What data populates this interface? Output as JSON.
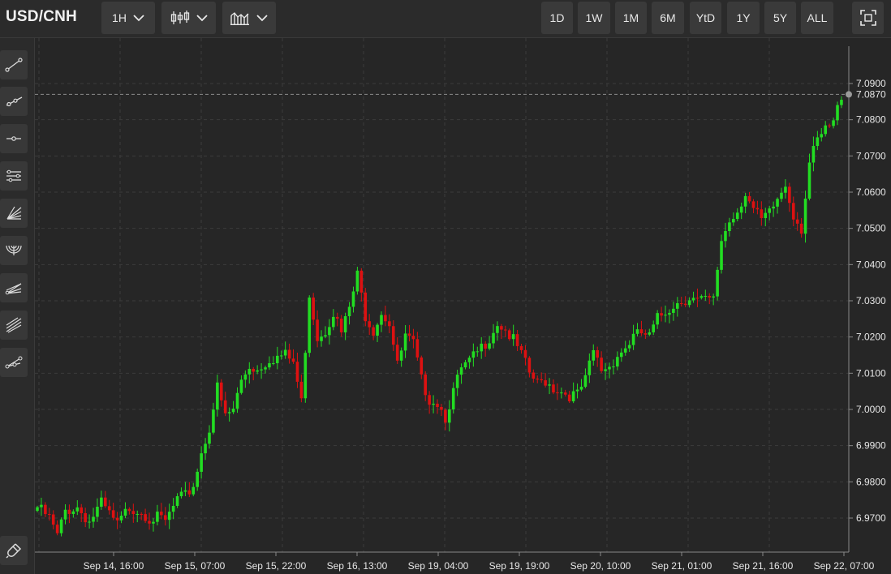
{
  "symbol": "USD/CNH",
  "toolbar": {
    "interval_label": "1H",
    "ranges": [
      "1D",
      "1W",
      "1M",
      "6M",
      "YtD",
      "1Y",
      "5Y",
      "ALL"
    ]
  },
  "sidebar_tools": [
    "trend-line-icon",
    "ray-icon",
    "horizontal-line-icon",
    "parallel-channel-icon",
    "fan-icon",
    "arc-icon",
    "pitchfork-icon",
    "multi-line-icon",
    "path-icon"
  ],
  "colors": {
    "up": "#22dd22",
    "down": "#dd1111",
    "background": "#262626",
    "grid": "#3c3c3c"
  },
  "chart_data": {
    "type": "candlestick",
    "y_ticks": [
      "7.0900",
      "7.0800",
      "7.0700",
      "7.0600",
      "7.0500",
      "7.0400",
      "7.0300",
      "7.0200",
      "7.0100",
      "7.0000",
      "6.9900",
      "6.9800",
      "6.9700"
    ],
    "ylim": [
      6.9655,
      7.0995
    ],
    "current_price": "7.0870",
    "x_tick_labels": [
      "Sep 14, 16:00",
      "Sep 15, 07:00",
      "Sep 15, 22:00",
      "Sep 16, 13:00",
      "Sep 19, 04:00",
      "Sep 19, 19:00",
      "Sep 20, 10:00",
      "Sep 21, 01:00",
      "Sep 21, 16:00",
      "Sep 22, 07:00"
    ],
    "path_points": [
      [
        0,
        6.973
      ],
      [
        3,
        6.97
      ],
      [
        5,
        6.965
      ],
      [
        7,
        6.972
      ],
      [
        10,
        6.973
      ],
      [
        13,
        6.969
      ],
      [
        16,
        6.974
      ],
      [
        18,
        6.971
      ],
      [
        20,
        6.968
      ],
      [
        23,
        6.973
      ],
      [
        26,
        6.972
      ],
      [
        28,
        6.97
      ],
      [
        30,
        6.97
      ],
      [
        32,
        6.969
      ],
      [
        35,
        6.975
      ],
      [
        37,
        6.976
      ],
      [
        39,
        6.979
      ],
      [
        41,
        6.988
      ],
      [
        43,
        6.995
      ],
      [
        45,
        7.006
      ],
      [
        47,
        6.998
      ],
      [
        49,
        7.0
      ],
      [
        51,
        7.008
      ],
      [
        53,
        7.012
      ],
      [
        55,
        7.011
      ],
      [
        58,
        7.014
      ],
      [
        62,
        7.015
      ],
      [
        64,
        7.013
      ],
      [
        66,
        7.002
      ],
      [
        68,
        7.032
      ],
      [
        70,
        7.02
      ],
      [
        72,
        7.022
      ],
      [
        74,
        7.027
      ],
      [
        76,
        7.021
      ],
      [
        78,
        7.028
      ],
      [
        80,
        7.037
      ],
      [
        82,
        7.026
      ],
      [
        84,
        7.022
      ],
      [
        86,
        7.027
      ],
      [
        88,
        7.024
      ],
      [
        90,
        7.012
      ],
      [
        92,
        7.02
      ],
      [
        94,
        7.018
      ],
      [
        96,
        7.008
      ],
      [
        98,
        7.003
      ],
      [
        100,
        7.002
      ],
      [
        102,
        6.998
      ],
      [
        104,
        7.005
      ],
      [
        106,
        7.011
      ],
      [
        108,
        7.013
      ],
      [
        111,
        7.017
      ],
      [
        113,
        7.02
      ],
      [
        115,
        7.024
      ],
      [
        117,
        7.022
      ],
      [
        119,
        7.019
      ],
      [
        121,
        7.015
      ],
      [
        123,
        7.01
      ],
      [
        125,
        7.007
      ],
      [
        127,
        7.008
      ],
      [
        129,
        7.006
      ],
      [
        131,
        7.005
      ],
      [
        133,
        7.004
      ],
      [
        135,
        7.004
      ],
      [
        137,
        7.008
      ],
      [
        139,
        7.016
      ],
      [
        141,
        7.011
      ],
      [
        143,
        7.012
      ],
      [
        145,
        7.015
      ],
      [
        147,
        7.017
      ],
      [
        149,
        7.02
      ],
      [
        151,
        7.021
      ],
      [
        153,
        7.02
      ],
      [
        155,
        7.025
      ],
      [
        157,
        7.027
      ],
      [
        159,
        7.029
      ],
      [
        161,
        7.03
      ],
      [
        163,
        7.031
      ],
      [
        165,
        7.03
      ],
      [
        167,
        7.03
      ],
      [
        169,
        7.03
      ],
      [
        171,
        7.047
      ],
      [
        173,
        7.052
      ],
      [
        175,
        7.055
      ],
      [
        177,
        7.06
      ],
      [
        179,
        7.055
      ],
      [
        181,
        7.052
      ],
      [
        183,
        7.054
      ],
      [
        185,
        7.058
      ],
      [
        187,
        7.062
      ],
      [
        189,
        7.054
      ],
      [
        191,
        7.05
      ],
      [
        193,
        7.068
      ],
      [
        195,
        7.074
      ],
      [
        197,
        7.077
      ],
      [
        199,
        7.079
      ],
      [
        201,
        7.087
      ]
    ]
  }
}
